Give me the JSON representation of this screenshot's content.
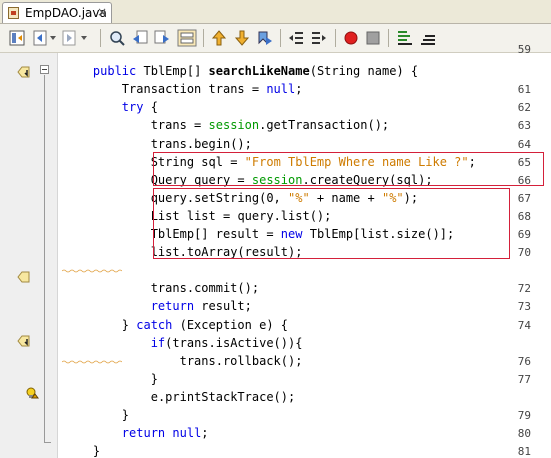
{
  "tab": {
    "title": "EmpDAO.java",
    "close": "×"
  },
  "toolbar": {
    "buttons": [
      "toggle-view",
      "back-history",
      "forward-history",
      "find",
      "find-previous",
      "find-next",
      "toggle-highlight",
      "toggle-bookmark-up",
      "next-bookmark",
      "previous-bookmark",
      "shift-left",
      "shift-right",
      "start-macro",
      "stop-macro",
      "comment",
      "uncomment"
    ]
  },
  "editor": {
    "lines": [
      {
        "num": "59",
        "partial": true
      },
      {
        "num": "",
        "text": "    public TblEmp[] searchLikeName(String name) {"
      },
      {
        "num": "61",
        "text": "        Transaction trans = null;"
      },
      {
        "num": "62",
        "text": "        try {"
      },
      {
        "num": "63",
        "text": "            trans = session.getTransaction();"
      },
      {
        "num": "64",
        "text": "            trans.begin();"
      },
      {
        "num": "65",
        "text": "            String sql = \"From TblEmp Where name Like ?\";"
      },
      {
        "num": "66",
        "text": "            Query query = session.createQuery(sql);"
      },
      {
        "num": "67",
        "text": "            query.setString(0, \"%\" + name + \"%\");"
      },
      {
        "num": "68",
        "text": "            List list = query.list();"
      },
      {
        "num": "69",
        "text": "            TblEmp[] result = new TblEmp[list.size()];"
      },
      {
        "num": "70",
        "text": "            list.toArray(result);"
      },
      {
        "num": "",
        "text": ""
      },
      {
        "num": "72",
        "text": "            trans.commit();"
      },
      {
        "num": "73",
        "text": "            return result;"
      },
      {
        "num": "74",
        "text": "        } catch (Exception e) {"
      },
      {
        "num": "",
        "text": "            if(trans.isActive()){"
      },
      {
        "num": "76",
        "text": "                trans.rollback();"
      },
      {
        "num": "77",
        "text": "            }"
      },
      {
        "num": "",
        "text": "            e.printStackTrace();"
      },
      {
        "num": "79",
        "text": "        }"
      },
      {
        "num": "80",
        "text": "        return null;"
      },
      {
        "num": "81",
        "text": "    }"
      }
    ],
    "tokens": {
      "l60": [
        "public",
        "TblEmp[]",
        "searchLikeName",
        "(String name) {"
      ],
      "l61": [
        "Transaction trans = ",
        "null",
        ";"
      ],
      "l62": [
        "try",
        " {"
      ],
      "l63": [
        "trans = ",
        "session",
        ".getTransaction();"
      ],
      "l64": [
        "trans.begin();"
      ],
      "l65": [
        "String sql = ",
        "\"From TblEmp Where name Like ?\"",
        ";"
      ],
      "l66": [
        "Query query = ",
        "session",
        ".createQuery(sql);"
      ],
      "l67": [
        "query.setString(0, ",
        "\"%\"",
        " + name + ",
        "\"%\"",
        ");"
      ],
      "l68": [
        "List list = query.list();"
      ],
      "l69": [
        "TblEmp[] result = ",
        "new",
        " TblEmp[list.size()];"
      ],
      "l70": [
        "list.toArray(result);"
      ],
      "l72": [
        "trans.commit();"
      ],
      "l73": [
        "return",
        " result;"
      ],
      "l74": [
        "} ",
        "catch",
        " (Exception e) {"
      ],
      "l75": [
        "if",
        "(trans.isActive()){"
      ],
      "l76": [
        "trans.rollback();"
      ],
      "l77": [
        "}"
      ],
      "l78": [
        "e.printStackTrace();"
      ],
      "l79": [
        "}"
      ],
      "l80": [
        "return",
        " null",
        ";"
      ],
      "l81": [
        "}"
      ]
    }
  }
}
